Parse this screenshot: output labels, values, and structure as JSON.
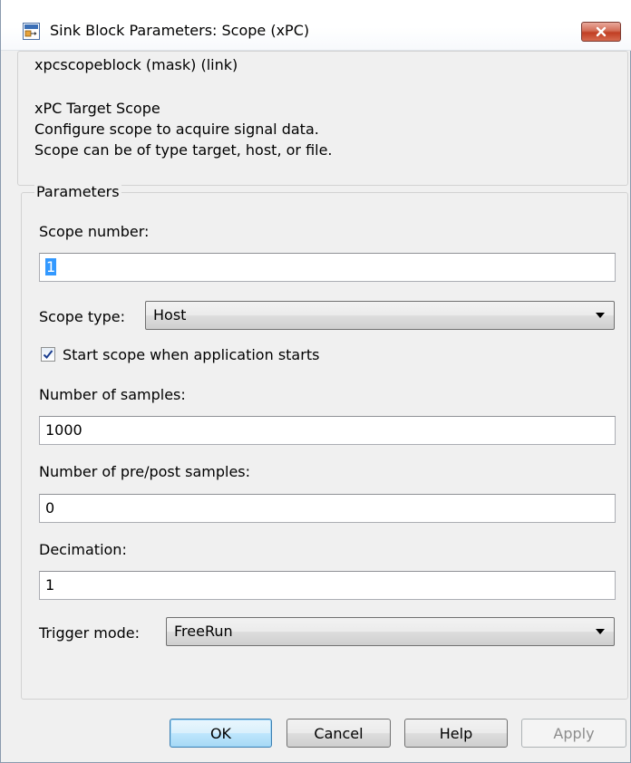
{
  "window": {
    "title": "Sink Block Parameters: Scope (xPC)"
  },
  "mask": {
    "header": "xpcscopeblock (mask) (link)",
    "description": [
      "xPC Target Scope",
      "Configure scope to acquire signal data.",
      "Scope can be of type target, host, or file."
    ]
  },
  "parameters": {
    "group_label": "Parameters",
    "scope_number": {
      "label": "Scope number:",
      "value": "1"
    },
    "scope_type": {
      "label": "Scope type:",
      "value": "Host"
    },
    "start_scope": {
      "label": "Start scope when application starts",
      "checked": true
    },
    "num_samples": {
      "label": "Number of samples:",
      "value": "1000"
    },
    "num_prepost": {
      "label": "Number of pre/post samples:",
      "value": "0"
    },
    "decimation": {
      "label": "Decimation:",
      "value": "1"
    },
    "trigger_mode": {
      "label": "Trigger mode:",
      "value": "FreeRun"
    }
  },
  "buttons": {
    "ok": "OK",
    "cancel": "Cancel",
    "help": "Help",
    "apply": "Apply"
  },
  "icons": {
    "app": "simulink-block-icon",
    "close": "close-icon",
    "dropdown": "chevron-down-icon",
    "check": "checkmark-icon"
  },
  "colors": {
    "close_button": "#c74a31",
    "selection": "#3399ff",
    "default_button_border": "#3c7fb1"
  }
}
